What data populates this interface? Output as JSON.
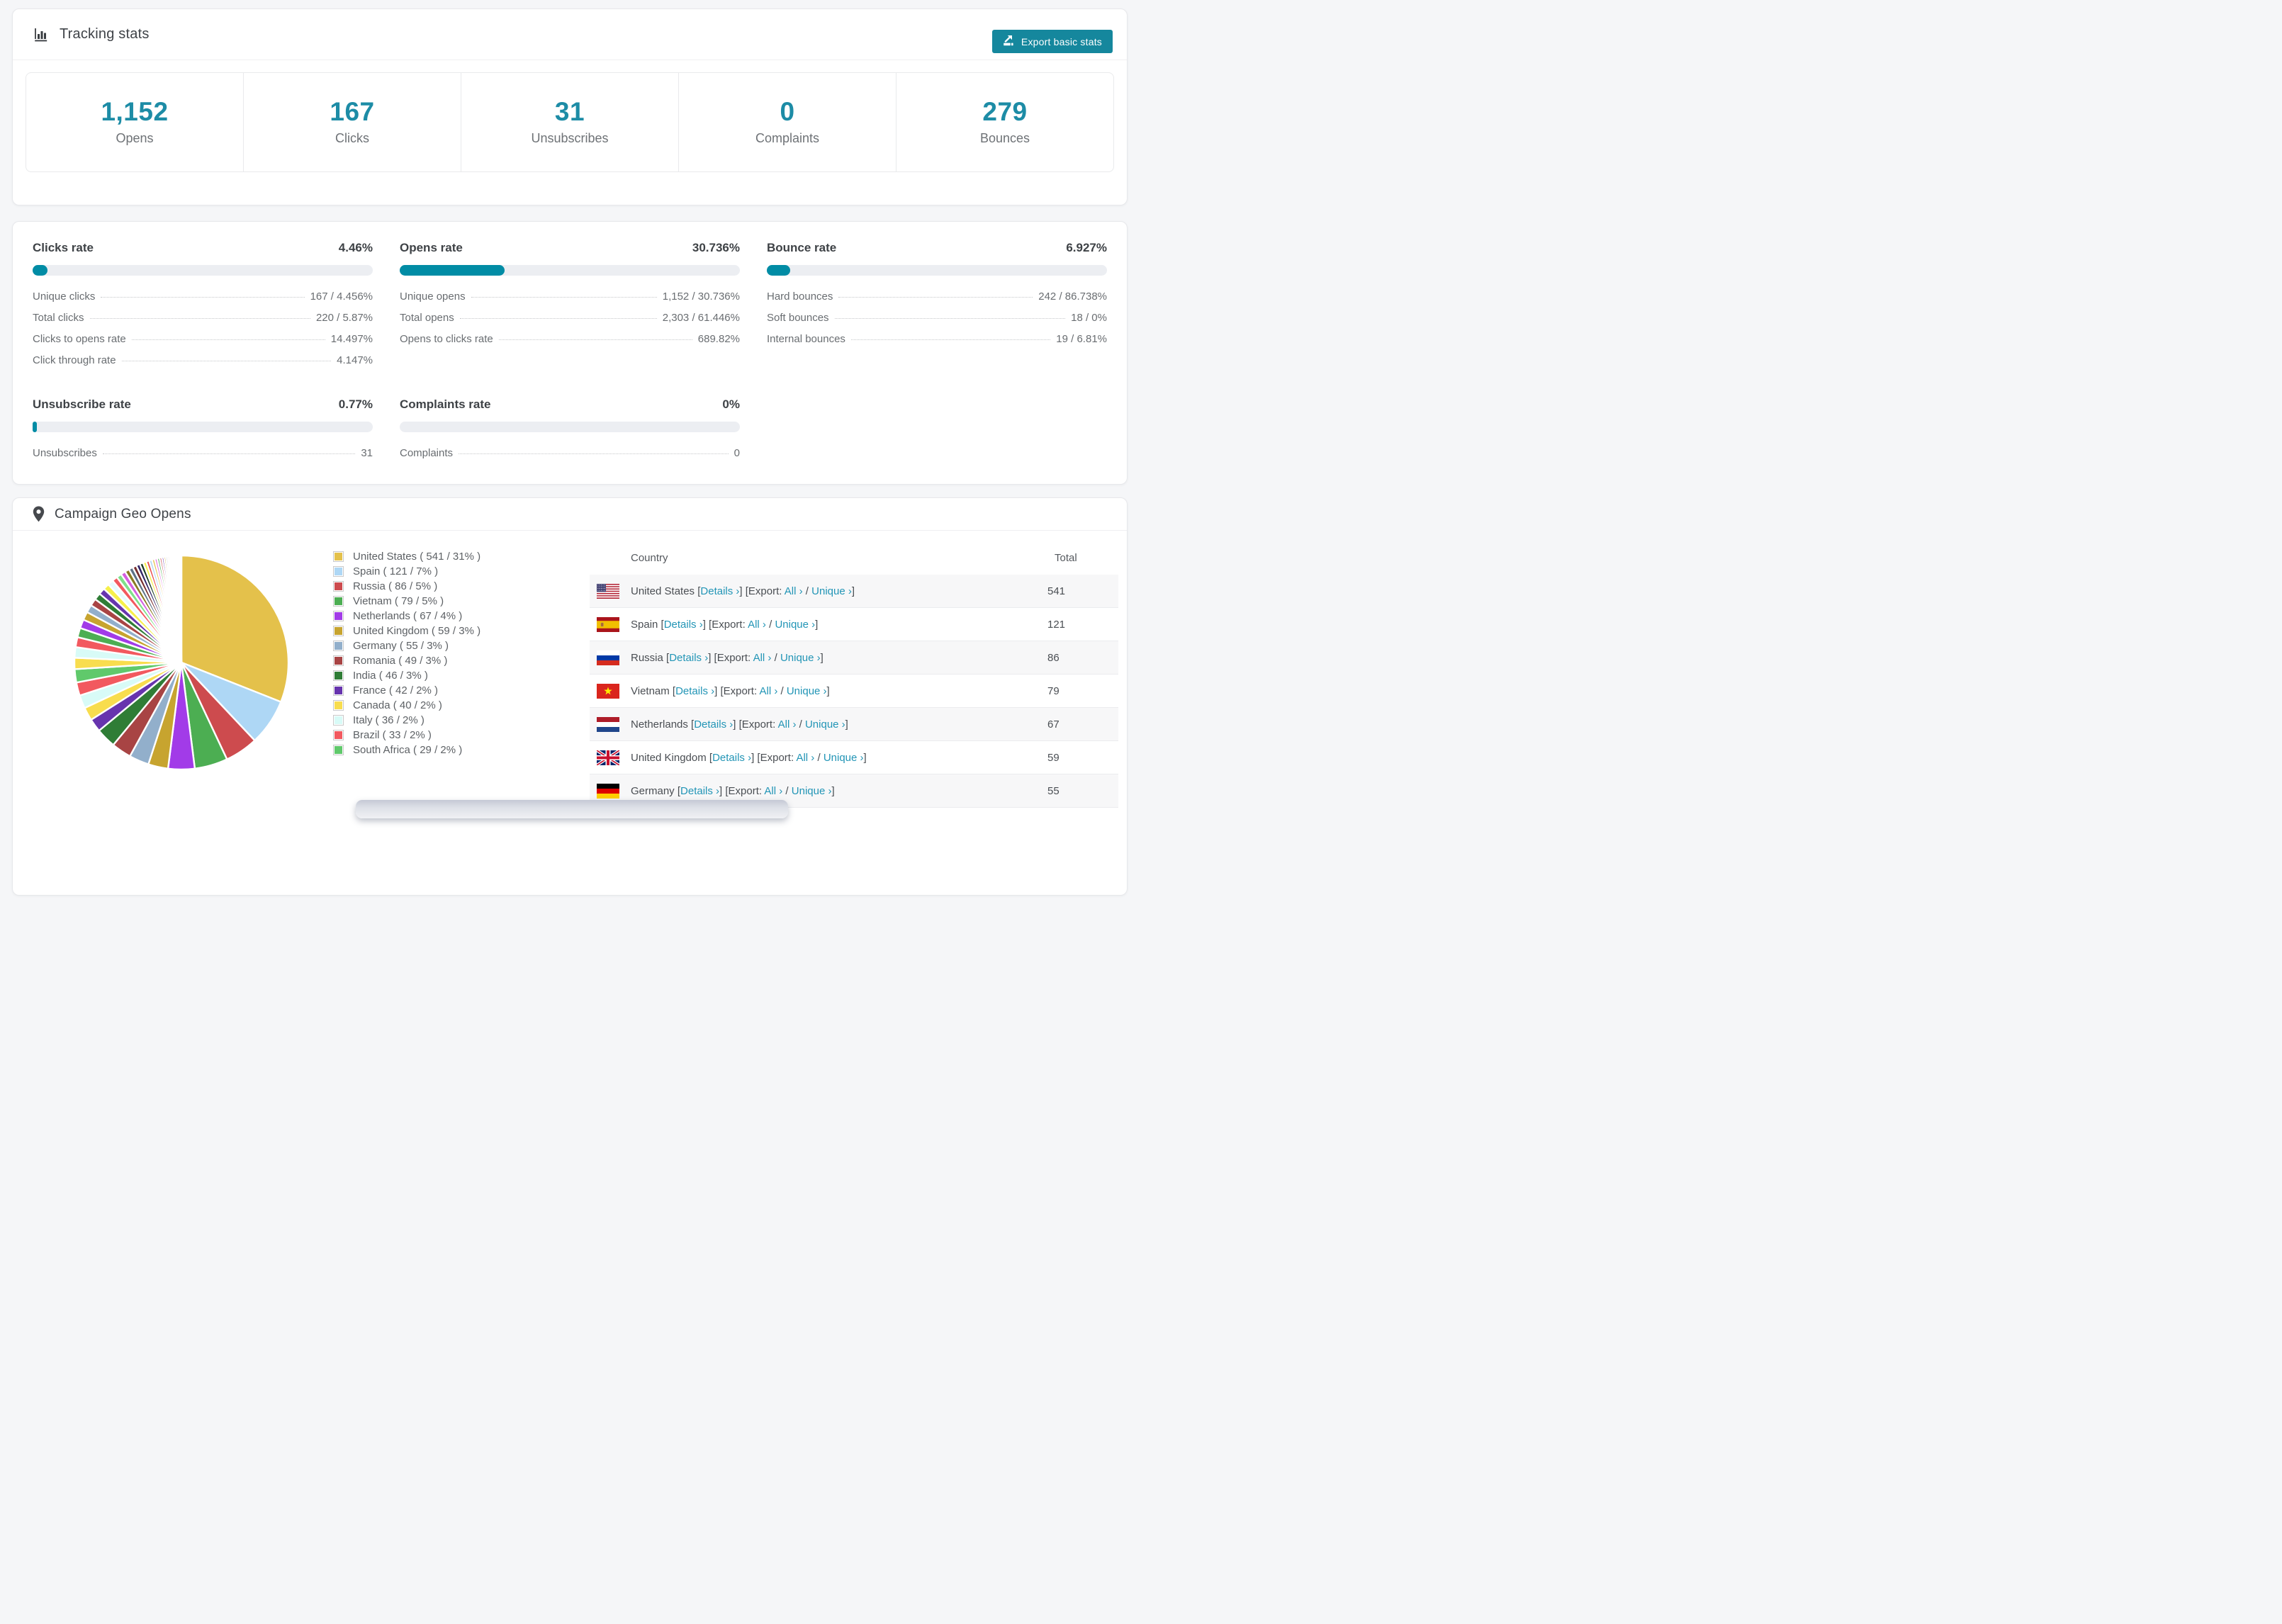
{
  "colors": {
    "accent_button": "#15879d",
    "bar_fill": "#018ca5",
    "big_number": "#1d8ca6",
    "link": "#2295b6"
  },
  "tracking": {
    "title": "Tracking stats",
    "export_label": "Export basic stats",
    "stats": [
      {
        "value": "1,152",
        "label": "Opens"
      },
      {
        "value": "167",
        "label": "Clicks"
      },
      {
        "value": "31",
        "label": "Unsubscribes"
      },
      {
        "value": "0",
        "label": "Complaints"
      },
      {
        "value": "279",
        "label": "Bounces"
      }
    ]
  },
  "rates": [
    {
      "title": "Clicks rate",
      "value": "4.46%",
      "pct": 4.46,
      "rows": [
        {
          "label": "Unique clicks",
          "value": "167 / 4.456%"
        },
        {
          "label": "Total clicks",
          "value": "220 / 5.87%"
        },
        {
          "label": "Clicks to opens rate",
          "value": "14.497%"
        },
        {
          "label": "Click through rate",
          "value": "4.147%"
        }
      ]
    },
    {
      "title": "Opens rate",
      "value": "30.736%",
      "pct": 30.736,
      "rows": [
        {
          "label": "Unique opens",
          "value": "1,152 / 30.736%"
        },
        {
          "label": "Total opens",
          "value": "2,303 / 61.446%"
        },
        {
          "label": "Opens to clicks rate",
          "value": "689.82%"
        }
      ]
    },
    {
      "title": "Bounce rate",
      "value": "6.927%",
      "pct": 6.927,
      "rows": [
        {
          "label": "Hard bounces",
          "value": "242 / 86.738%"
        },
        {
          "label": "Soft bounces",
          "value": "18 / 0%"
        },
        {
          "label": "Internal bounces",
          "value": "19 / 6.81%"
        }
      ]
    },
    {
      "title": "Unsubscribe rate",
      "value": "0.77%",
      "pct": 0.77,
      "rows": [
        {
          "label": "Unsubscribes",
          "value": "31"
        }
      ]
    },
    {
      "title": "Complaints rate",
      "value": "0%",
      "pct": 0,
      "rows": [
        {
          "label": "Complaints",
          "value": "0"
        }
      ]
    }
  ],
  "geo": {
    "title": "Campaign Geo Opens",
    "legend": [
      {
        "country": "United States",
        "total": 541,
        "pct": 31,
        "color": "#e4c14b",
        "flag": "us"
      },
      {
        "country": "Spain",
        "total": 121,
        "pct": 7,
        "color": "#aed7f5",
        "flag": "es"
      },
      {
        "country": "Russia",
        "total": 86,
        "pct": 5,
        "color": "#cd4b4e",
        "flag": "ru"
      },
      {
        "country": "Vietnam",
        "total": 79,
        "pct": 5,
        "color": "#4cae52",
        "flag": "vn"
      },
      {
        "country": "Netherlands",
        "total": 67,
        "pct": 4,
        "color": "#a23be8",
        "flag": "nl"
      },
      {
        "country": "United Kingdom",
        "total": 59,
        "pct": 3,
        "color": "#c7a42f",
        "flag": "gb"
      },
      {
        "country": "Germany",
        "total": 55,
        "pct": 3,
        "color": "#92afcb",
        "flag": "de"
      },
      {
        "country": "Romania",
        "total": 49,
        "pct": 3,
        "color": "#a84444",
        "flag": "ro"
      },
      {
        "country": "India",
        "total": 46,
        "pct": 3,
        "color": "#2f7d36",
        "flag": "in"
      },
      {
        "country": "France",
        "total": 42,
        "pct": 2,
        "color": "#6734ae",
        "flag": "fr"
      },
      {
        "country": "Canada",
        "total": 40,
        "pct": 2,
        "color": "#f8dd4e",
        "flag": "ca"
      },
      {
        "country": "Italy",
        "total": 36,
        "pct": 2,
        "color": "#d8fbf7",
        "flag": "it"
      },
      {
        "country": "Brazil",
        "total": 33,
        "pct": 2,
        "color": "#f2595f",
        "flag": "br"
      },
      {
        "country": "South Africa",
        "total": 29,
        "pct": 2,
        "color": "#60c96b",
        "flag": "za"
      }
    ],
    "table": {
      "columns": [
        "Country",
        "Total"
      ],
      "visible_rows": 7,
      "details_label": "Details",
      "export_label": "Export:",
      "all_label": "All",
      "unique_label": "Unique",
      "chevron": "›"
    },
    "chart_data": {
      "type": "pie",
      "title": "Campaign Geo Opens",
      "labels": [
        "United States",
        "Spain",
        "Russia",
        "Vietnam",
        "Netherlands",
        "United Kingdom",
        "Germany",
        "Romania",
        "India",
        "France",
        "Canada",
        "Italy",
        "Brazil",
        "South Africa"
      ],
      "values": [
        541,
        121,
        86,
        79,
        67,
        59,
        55,
        49,
        46,
        42,
        40,
        36,
        33,
        29
      ],
      "pct": [
        31,
        7,
        5,
        5,
        4,
        3,
        3,
        3,
        3,
        2,
        2,
        2,
        2,
        2
      ],
      "legend_position": "right",
      "others": {
        "total_pct": 26,
        "segments": 40,
        "decay": 0.94,
        "palette": [
          "#f8dd4e",
          "#d8fbf7",
          "#f2595f",
          "#4cae52",
          "#a23be8",
          "#c7a42f",
          "#92afcb",
          "#a84444",
          "#2f7d36",
          "#6734ae",
          "#f6f04a",
          "#e6fbff",
          "#f2595f",
          "#7fe08a",
          "#d45fe0",
          "#8a7a22",
          "#5c7186",
          "#772f30",
          "#322668",
          "#1d3d26",
          "#f6f04a",
          "#e84b4b",
          "#aed7f5",
          "#e4c14b",
          "#e06ee0",
          "#4cae52",
          "#cd4b4e",
          "#6734ae",
          "#c7a42f",
          "#92afcb",
          "#a84444",
          "#2f7d36",
          "#f8dd4e",
          "#d8fbf7",
          "#f2595f",
          "#4cae52",
          "#a23be8",
          "#c7a42f",
          "#92afcb",
          "#a84444"
        ]
      }
    }
  }
}
